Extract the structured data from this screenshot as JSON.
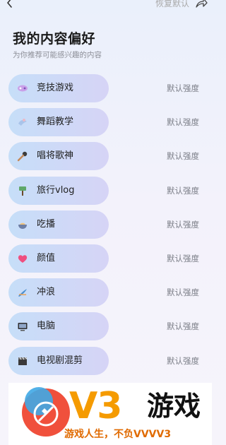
{
  "header": {
    "restore_label": "恢复默认"
  },
  "page": {
    "title": "我的内容偏好",
    "subtitle": "为你推荐可能感兴趣的内容"
  },
  "items": [
    {
      "label": "竞技游戏",
      "icon": "game-controller-icon",
      "level": "默认强度"
    },
    {
      "label": "舞蹈教学",
      "icon": "dance-icon",
      "level": "默认强度"
    },
    {
      "label": "唱将歌神",
      "icon": "microphone-icon",
      "level": "默认强度"
    },
    {
      "label": "旅行vlog",
      "icon": "signpost-icon",
      "level": "默认强度"
    },
    {
      "label": "吃播",
      "icon": "food-bowl-icon",
      "level": "默认强度"
    },
    {
      "label": "颜值",
      "icon": "heart-icon",
      "level": "默认强度"
    },
    {
      "label": "冲浪",
      "icon": "surfboard-icon",
      "level": "默认强度"
    },
    {
      "label": "电脑",
      "icon": "computer-icon",
      "level": "默认强度"
    },
    {
      "label": "电视剧混剪",
      "icon": "clapperboard-icon",
      "level": "默认强度"
    }
  ],
  "watermark": {
    "brand": "V3",
    "name": "游戏",
    "slogan": "游戏人生，不负VVVV3"
  },
  "colors": {
    "pill_start": "#c6def8",
    "pill_end": "#d6d4f6",
    "brand_orange": "#f59b00",
    "text_muted": "#7c7f88"
  }
}
